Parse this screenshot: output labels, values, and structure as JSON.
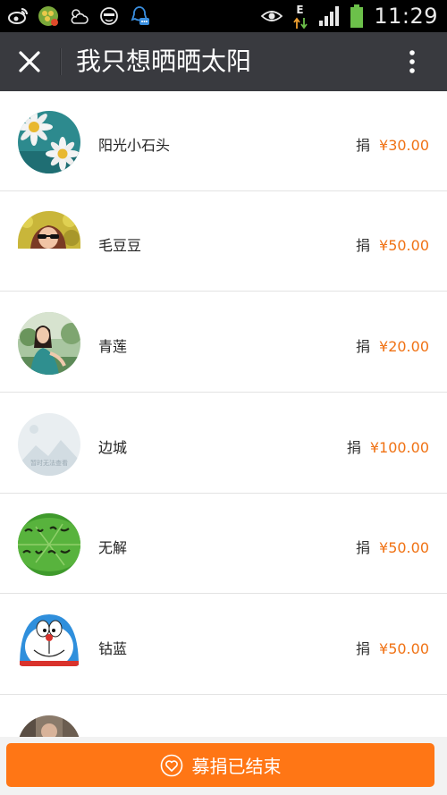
{
  "status_bar": {
    "time": "11:29",
    "network_type": "E",
    "left_icons": [
      "weibo-icon",
      "clover-game-icon",
      "weather-icon",
      "face-app-icon",
      "qq-message-icon"
    ],
    "right_icons": [
      "eye-icon",
      "data-arrows-icon",
      "signal-icon",
      "battery-icon"
    ],
    "battery_color": "#6cc04a"
  },
  "app_bar": {
    "title": "我只想晒晒太阳",
    "close_icon": "close-icon",
    "more_icon": "more-vertical-icon",
    "background": "#393a3f"
  },
  "donors": [
    {
      "name": "阳光小石头",
      "donate_label": "捐",
      "amount": "¥30.00",
      "avatar": "daisy-photo"
    },
    {
      "name": "毛豆豆",
      "donate_label": "捐",
      "amount": "¥50.00",
      "avatar": "person-sunglasses-photo"
    },
    {
      "name": "青莲",
      "donate_label": "捐",
      "amount": "¥20.00",
      "avatar": "woman-outdoor-photo"
    },
    {
      "name": "边城",
      "donate_label": "捐",
      "amount": "¥100.00",
      "avatar": "placeholder-image",
      "avatar_text": "暂时无法查看"
    },
    {
      "name": "无解",
      "donate_label": "捐",
      "amount": "¥50.00",
      "avatar": "calligraphy-leaf-photo"
    },
    {
      "name": "钴蓝",
      "donate_label": "捐",
      "amount": "¥50.00",
      "avatar": "doraemon-photo"
    },
    {
      "name": "",
      "donate_label": "",
      "amount": "",
      "avatar": "person-partial-photo"
    }
  ],
  "footer": {
    "button_label": "募捐已结束",
    "icon": "heart-icon",
    "accent_color": "#ff7615"
  },
  "colors": {
    "amount": "#f07214",
    "divider": "#e3e3e3"
  }
}
